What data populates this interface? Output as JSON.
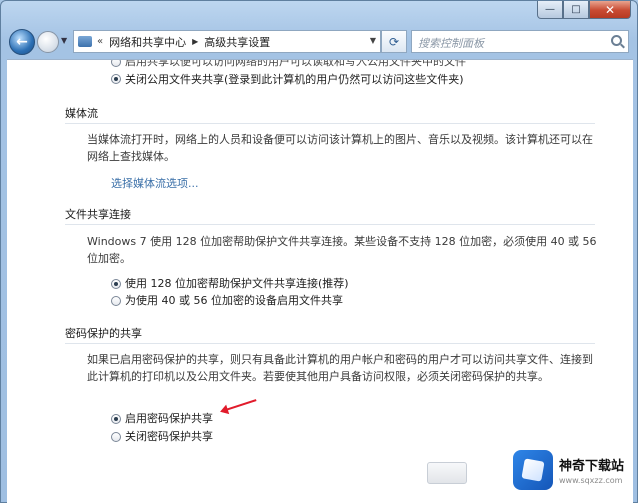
{
  "window": {
    "minimize": "—",
    "maximize": "□",
    "close": "✕"
  },
  "nav": {
    "crumb_prefix": "«",
    "crumbs": [
      "网络和共享中心",
      "高级共享设置"
    ],
    "search_placeholder": "搜索控制面板"
  },
  "public_folder": {
    "option_cut": "启用共享以便可以访问网络的用户可以读取和写入公用文件夹中的文件",
    "option_off": "关闭公用文件夹共享(登录到此计算机的用户仍然可以访问这些文件夹)"
  },
  "media": {
    "title": "媒体流",
    "desc": "当媒体流打开时，网络上的人员和设备便可以访问该计算机上的图片、音乐以及视频。该计算机还可以在网络上查找媒体。",
    "link": "选择媒体流选项..."
  },
  "file_sharing": {
    "title": "文件共享连接",
    "desc": "Windows 7 使用 128 位加密帮助保护文件共享连接。某些设备不支持 128 位加密，必须使用 40 或 56 位加密。",
    "option_128": "使用 128 位加密帮助保护文件共享连接(推荐)",
    "option_40_56": "为使用 40 或 56 位加密的设备启用文件共享"
  },
  "password": {
    "title": "密码保护的共享",
    "desc": "如果已启用密码保护的共享，则只有具备此计算机的用户帐户和密码的用户才可以访问共享文件、连接到此计算机的打印机以及公用文件夹。若要使其他用户具备访问权限，必须关闭密码保护的共享。",
    "option_on": "启用密码保护共享",
    "option_off": "关闭密码保护共享"
  },
  "watermark": {
    "name": "神奇下载站",
    "url": "www.sqxzz.com"
  }
}
